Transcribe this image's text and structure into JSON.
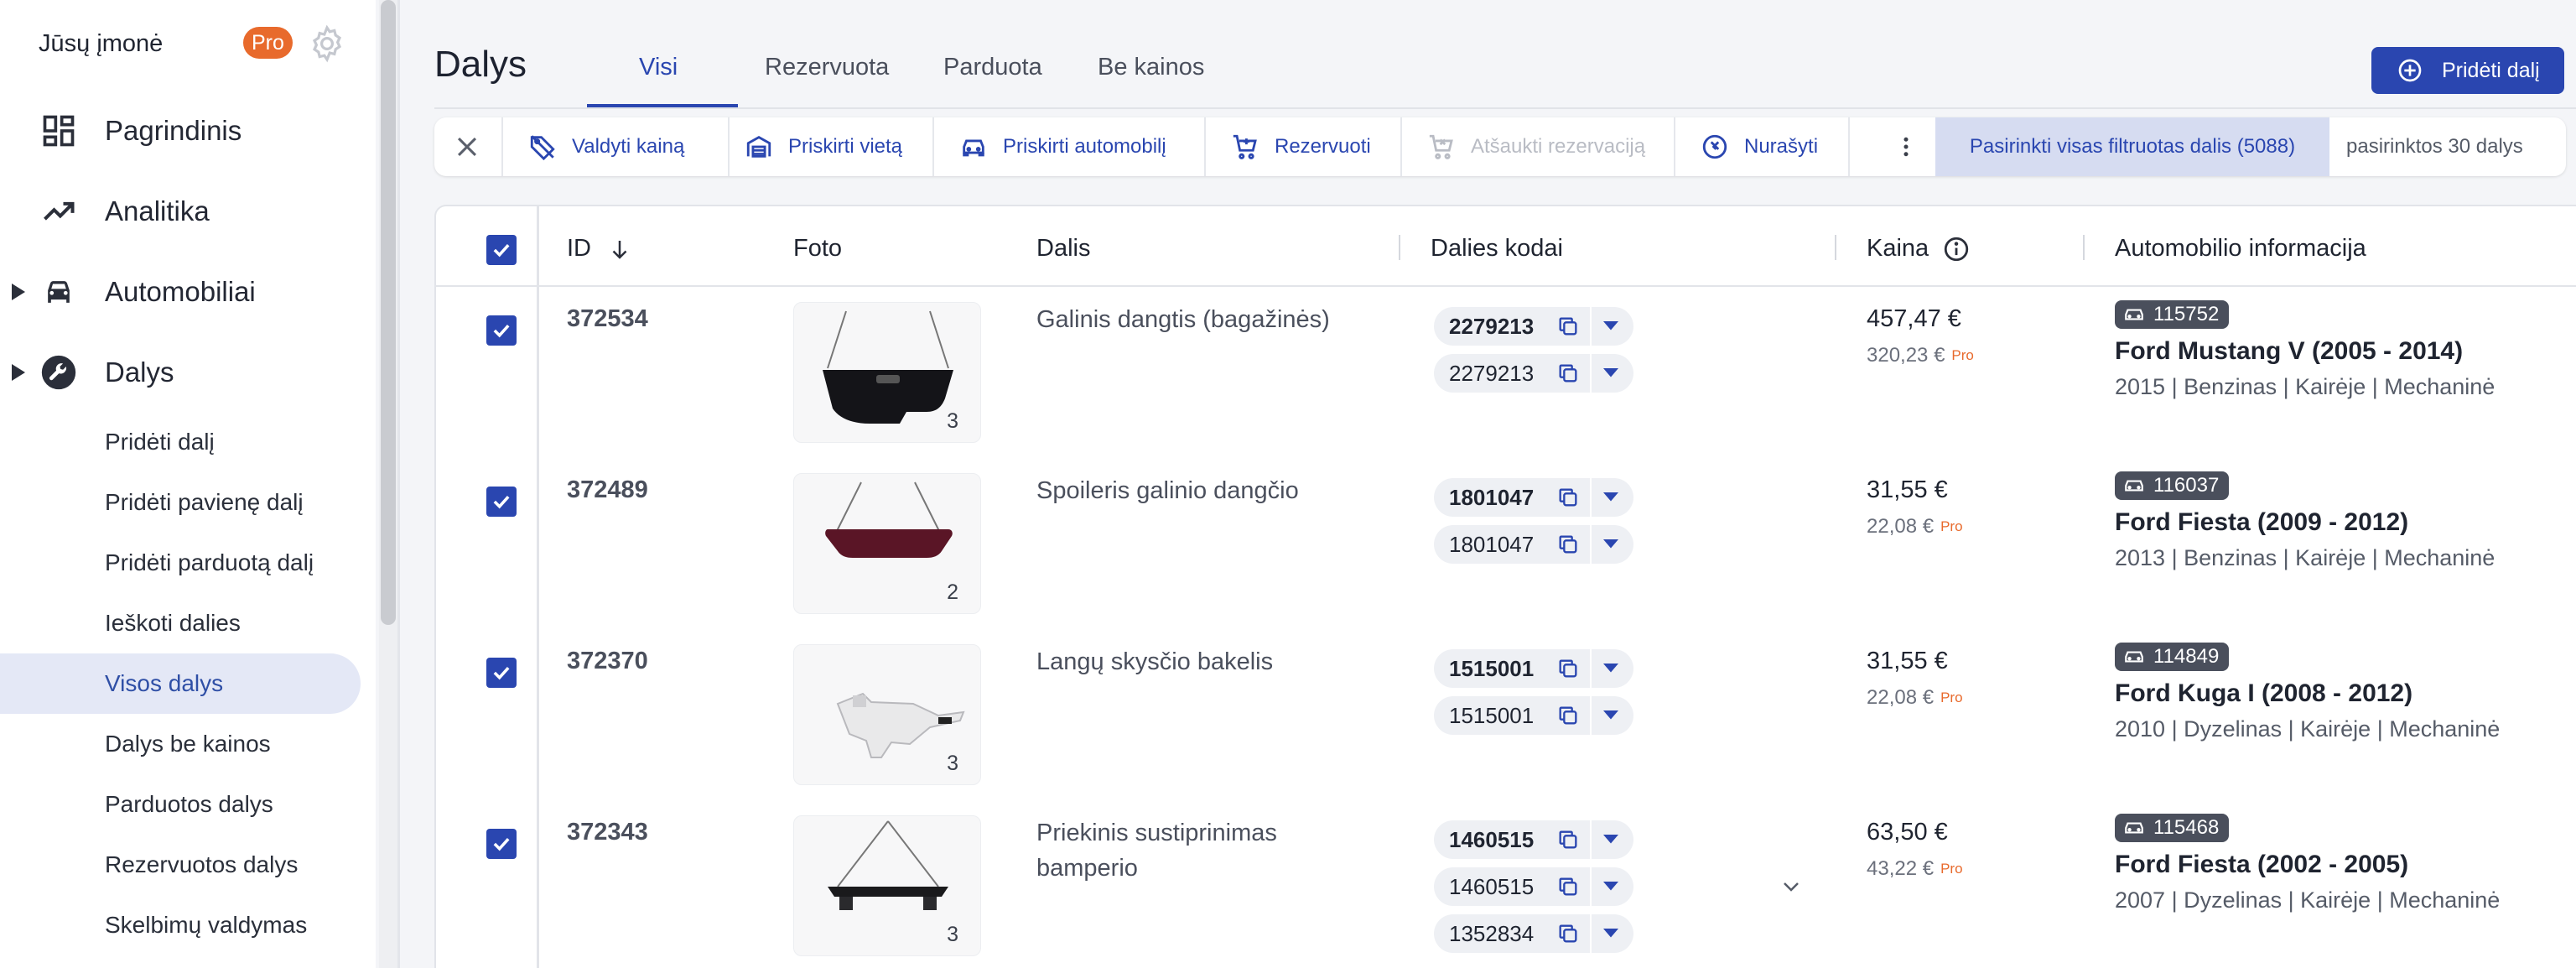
{
  "sidebar": {
    "company": "Jūsų įmonė",
    "pro_badge": "Pro",
    "main_items": [
      {
        "label": "Pagrindinis",
        "icon": "dashboard-icon"
      },
      {
        "label": "Analitika",
        "icon": "trending-icon"
      },
      {
        "label": "Automobiliai",
        "icon": "car-icon"
      },
      {
        "label": "Dalys",
        "icon": "wrench-icon"
      }
    ],
    "sub_items": [
      {
        "label": "Pridėti dalį"
      },
      {
        "label": "Pridėti pavienę dalį"
      },
      {
        "label": "Pridėti parduotą dalį"
      },
      {
        "label": "Ieškoti dalies"
      },
      {
        "label": "Visos dalys",
        "active": true
      },
      {
        "label": "Dalys be kainos"
      },
      {
        "label": "Parduotos dalys"
      },
      {
        "label": "Rezervuotos dalys"
      },
      {
        "label": "Skelbimų valdymas"
      }
    ]
  },
  "header": {
    "title": "Dalys",
    "tabs": [
      {
        "label": "Visi",
        "active": true
      },
      {
        "label": "Rezervuota"
      },
      {
        "label": "Parduota"
      },
      {
        "label": "Be kainos"
      }
    ],
    "add_button": "Pridėti dalį"
  },
  "toolbar": {
    "actions": [
      {
        "label": "Valdyti kainą",
        "icon": "price-tag-icon"
      },
      {
        "label": "Priskirti vietą",
        "icon": "warehouse-icon"
      },
      {
        "label": "Priskirti automobilį",
        "icon": "car-icon"
      },
      {
        "label": "Rezervuoti",
        "icon": "cart-icon"
      },
      {
        "label": "Atšaukti rezervaciją",
        "icon": "cart-off-icon",
        "disabled": true
      },
      {
        "label": "Nurašyti",
        "icon": "write-off-icon"
      }
    ],
    "select_all": "Pasirinkti visas filtruotas dalis (5088)",
    "selected_count": "pasirinktos 30 dalys"
  },
  "table": {
    "headers": {
      "id": "ID",
      "photo": "Foto",
      "part": "Dalis",
      "codes": "Dalies kodai",
      "price": "Kaina",
      "car_info": "Automobilio informacija"
    },
    "rows": [
      {
        "id": "372534",
        "photo_count": "3",
        "name": "Galinis dangtis (bagažinės)",
        "codes": [
          "2279213",
          "2279213"
        ],
        "price": "457,47 €",
        "price_pro": "320,23 €",
        "pro_label": "Pro",
        "car_tag": "115752",
        "car_name": "Ford Mustang V (2005 - 2014)",
        "car_meta": "2015 | Benzinas | Kairėje | Mechaninė"
      },
      {
        "id": "372489",
        "photo_count": "2",
        "name": "Spoileris galinio dangčio",
        "codes": [
          "1801047",
          "1801047"
        ],
        "price": "31,55 €",
        "price_pro": "22,08 €",
        "pro_label": "Pro",
        "car_tag": "116037",
        "car_name": "Ford Fiesta (2009 - 2012)",
        "car_meta": "2013 | Benzinas | Kairėje | Mechaninė"
      },
      {
        "id": "372370",
        "photo_count": "3",
        "name": "Langų skysčio bakelis",
        "codes": [
          "1515001",
          "1515001"
        ],
        "price": "31,55 €",
        "price_pro": "22,08 €",
        "pro_label": "Pro",
        "car_tag": "114849",
        "car_name": "Ford Kuga I (2008 - 2012)",
        "car_meta": "2010 | Dyzelinas | Kairėje | Mechaninė"
      },
      {
        "id": "372343",
        "photo_count": "3",
        "name": "Priekinis sustiprinimas bamperio",
        "codes": [
          "1460515",
          "1460515",
          "1352834"
        ],
        "price": "63,50 €",
        "price_pro": "43,22 €",
        "pro_label": "Pro",
        "car_tag": "115468",
        "car_name": "Ford Fiesta (2002 - 2005)",
        "car_meta": "2007 | Dyzelinas | Kairėje | Mechaninė"
      }
    ]
  },
  "colors": {
    "primary": "#2a46b0",
    "pro_orange": "#e86a2c",
    "active_bg": "#e4e8f6"
  }
}
